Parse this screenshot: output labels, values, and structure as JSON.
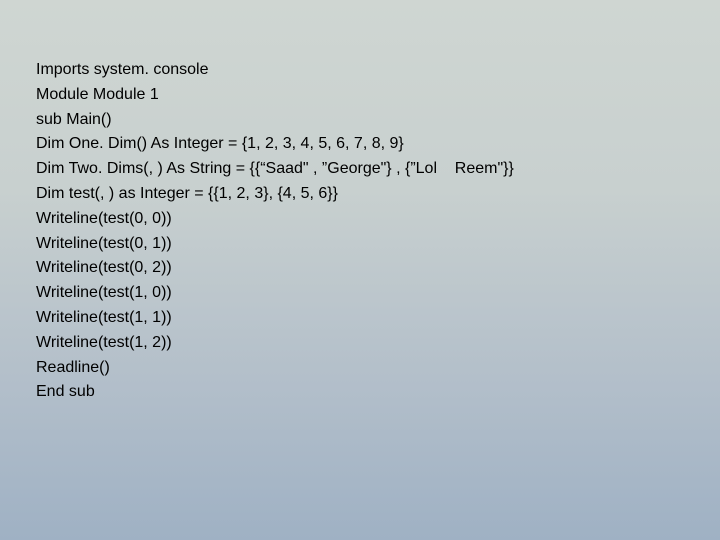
{
  "code": {
    "lines": [
      "Imports system. console",
      "Module Module 1",
      "sub Main()",
      "Dim One. Dim() As Integer = {1, 2, 3, 4, 5, 6, 7, 8, 9}",
      "Dim Two. Dims(, ) As String = {{“Saad\" , ”George\"} , {”Lol    Reem\"}}",
      "Dim test(, ) as Integer = {{1, 2, 3}, {4, 5, 6}}",
      "Writeline(test(0, 0))",
      "Writeline(test(0, 1))",
      "Writeline(test(0, 2))",
      "Writeline(test(1, 0))",
      "Writeline(test(1, 1))",
      "Writeline(test(1, 2))",
      "Readline()",
      "End sub"
    ]
  }
}
